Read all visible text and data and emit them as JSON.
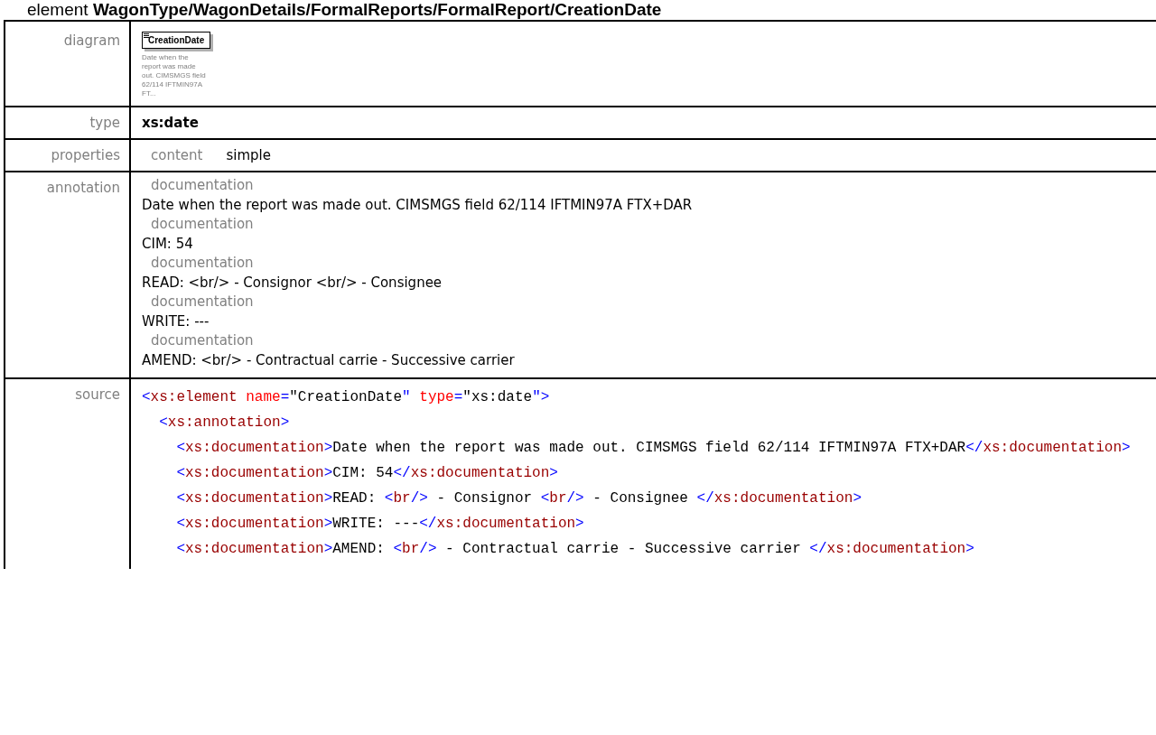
{
  "heading": "element **WagonType/WagonDetails/FormalReports/FormalReport/CreationDate**",
  "diagram": {
    "label": "diagram",
    "element_name": "CreationDate",
    "description": "Date when the report was made out. CIMSMGS field 62/114 IFTMIN97A FT..."
  },
  "type": {
    "label": "type",
    "value": "xs:date"
  },
  "properties": {
    "label": "properties",
    "items": [
      {
        "name": "content",
        "value": "simple"
      }
    ]
  },
  "annotation": {
    "label": "annotation",
    "items": [
      {
        "name": "documentation",
        "text": "Date when the report was made out. CIMSMGS field 62/114 IFTMIN97A FTX+DAR"
      },
      {
        "name": "documentation",
        "text": "CIM: 54"
      },
      {
        "name": "documentation",
        "text": "READ: <br/> - Consignor <br/> - Consignee"
      },
      {
        "name": "documentation",
        "text": "WRITE: ---"
      },
      {
        "name": "documentation",
        "text": "AMEND: <br/> - Contractual carrie - Successive carrier"
      }
    ]
  },
  "source": {
    "label": "source",
    "lines": [
      {
        "tokens": [
          {
            "kind": "punct",
            "text": "<"
          },
          {
            "kind": "tag",
            "text": "xs:element"
          },
          {
            "kind": "attr",
            "text": " name"
          },
          {
            "kind": "punct",
            "text": "="
          },
          {
            "kind": "text",
            "text": "\"CreationDate"
          },
          {
            "kind": "punct",
            "text": "\""
          },
          {
            "kind": "attr",
            "text": " type"
          },
          {
            "kind": "punct",
            "text": "="
          },
          {
            "kind": "text",
            "text": "\"xs:date"
          },
          {
            "kind": "punct",
            "text": "\">"
          }
        ],
        "children": [
          {
            "tokens": [
              {
                "kind": "punct",
                "text": "<"
              },
              {
                "kind": "tag",
                "text": "xs:annotation"
              },
              {
                "kind": "punct",
                "text": ">"
              }
            ],
            "children": [
              {
                "tokens": [
                  {
                    "kind": "punct",
                    "text": "<"
                  },
                  {
                    "kind": "tag",
                    "text": "xs:documentation"
                  },
                  {
                    "kind": "punct",
                    "text": ">"
                  },
                  {
                    "kind": "text",
                    "text": "Date when the report was made out. CIMSMGS field 62/114 IFTMIN97A FTX+DAR"
                  },
                  {
                    "kind": "punct",
                    "text": "</"
                  },
                  {
                    "kind": "tag",
                    "text": "xs:documentation"
                  },
                  {
                    "kind": "punct",
                    "text": ">"
                  }
                ]
              },
              {
                "tokens": [
                  {
                    "kind": "punct",
                    "text": "<"
                  },
                  {
                    "kind": "tag",
                    "text": "xs:documentation"
                  },
                  {
                    "kind": "punct",
                    "text": ">"
                  },
                  {
                    "kind": "text",
                    "text": "CIM: 54"
                  },
                  {
                    "kind": "punct",
                    "text": "</"
                  },
                  {
                    "kind": "tag",
                    "text": "xs:documentation"
                  },
                  {
                    "kind": "punct",
                    "text": ">"
                  }
                ]
              },
              {
                "tokens": [
                  {
                    "kind": "punct",
                    "text": "<"
                  },
                  {
                    "kind": "tag",
                    "text": "xs:documentation"
                  },
                  {
                    "kind": "punct",
                    "text": ">"
                  },
                  {
                    "kind": "text",
                    "text": "READ: "
                  },
                  {
                    "kind": "punct",
                    "text": "<"
                  },
                  {
                    "kind": "tag",
                    "text": "br"
                  },
                  {
                    "kind": "punct",
                    "text": "/>"
                  },
                  {
                    "kind": "text",
                    "text": " - Consignor "
                  },
                  {
                    "kind": "punct",
                    "text": "<"
                  },
                  {
                    "kind": "tag",
                    "text": "br"
                  },
                  {
                    "kind": "punct",
                    "text": "/>"
                  },
                  {
                    "kind": "text",
                    "text": " - Consignee "
                  },
                  {
                    "kind": "punct",
                    "text": "</"
                  },
                  {
                    "kind": "tag",
                    "text": "xs:documentation"
                  },
                  {
                    "kind": "punct",
                    "text": ">"
                  }
                ]
              },
              {
                "tokens": [
                  {
                    "kind": "punct",
                    "text": "<"
                  },
                  {
                    "kind": "tag",
                    "text": "xs:documentation"
                  },
                  {
                    "kind": "punct",
                    "text": ">"
                  },
                  {
                    "kind": "text",
                    "text": "WRITE: ---"
                  },
                  {
                    "kind": "punct",
                    "text": "</"
                  },
                  {
                    "kind": "tag",
                    "text": "xs:documentation"
                  },
                  {
                    "kind": "punct",
                    "text": ">"
                  }
                ]
              },
              {
                "tokens": [
                  {
                    "kind": "punct",
                    "text": "<"
                  },
                  {
                    "kind": "tag",
                    "text": "xs:documentation"
                  },
                  {
                    "kind": "punct",
                    "text": ">"
                  },
                  {
                    "kind": "text",
                    "text": "AMEND: "
                  },
                  {
                    "kind": "punct",
                    "text": "<"
                  },
                  {
                    "kind": "tag",
                    "text": "br"
                  },
                  {
                    "kind": "punct",
                    "text": "/>"
                  },
                  {
                    "kind": "text",
                    "text": " - Contractual carrie - Successive carrier "
                  },
                  {
                    "kind": "punct",
                    "text": "</"
                  },
                  {
                    "kind": "tag",
                    "text": "xs:documentation"
                  },
                  {
                    "kind": "punct",
                    "text": ">"
                  }
                ]
              }
            ]
          }
        ]
      }
    ]
  }
}
